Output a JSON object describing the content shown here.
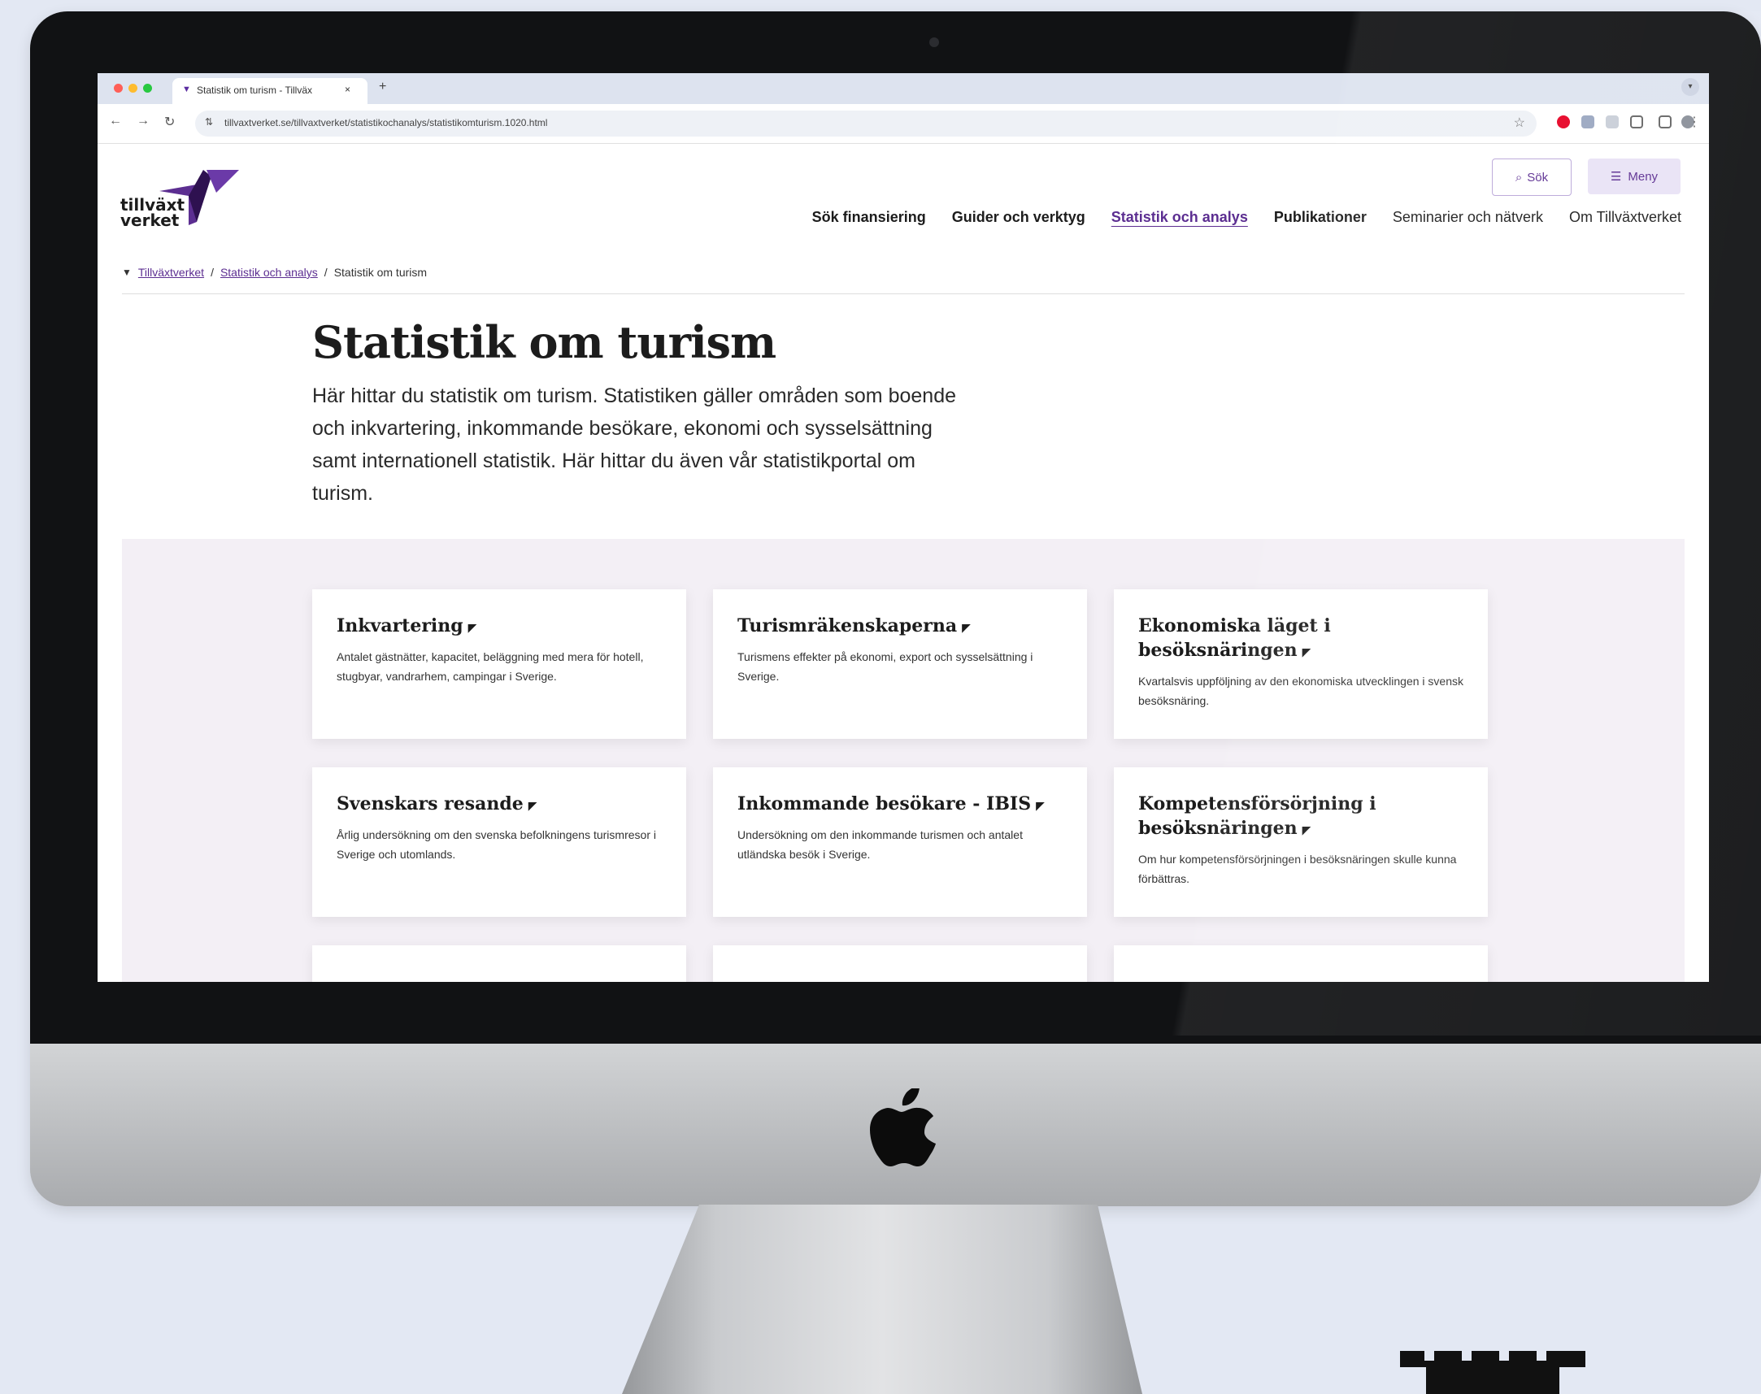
{
  "browser": {
    "tab_title": "Statistik om turism - Tillväx",
    "tab_close": "×",
    "new_tab": "+",
    "url": "tillvaxtverket.se/tillvaxtverket/statistikochanalys/statistikomturism.1020.html",
    "nav": {
      "back": "←",
      "forward": "→",
      "reload": "↻"
    },
    "traffic_colors": [
      "#ff5f57",
      "#febc2e",
      "#28c840"
    ]
  },
  "header": {
    "logo_line1": "tillväxt",
    "logo_line2": "verket",
    "search_label": "Sök",
    "menu_label": "Meny",
    "nav": [
      {
        "label": "Sök finansiering"
      },
      {
        "label": "Guider och verktyg"
      },
      {
        "label": "Statistik och analys"
      },
      {
        "label": "Publikationer"
      },
      {
        "label": "Seminarier och nätverk"
      },
      {
        "label": "Om Tillväxtverket"
      }
    ]
  },
  "breadcrumb": {
    "items": [
      "Tillväxtverket",
      "Statistik och analys",
      "Statistik om turism"
    ],
    "separator": "/"
  },
  "main": {
    "title": "Statistik om turism",
    "lead": "Här hittar du statistik om turism. Statistiken gäller områden som boende och inkvartering, inkommande besökare, ekonomi och sysselsättning samt internationell statistik. Här hittar du även vår statistikportal om turism."
  },
  "cards": [
    {
      "title": "Inkvartering",
      "desc": "Antalet gästnätter, kapacitet, beläggning med mera för hotell, stugbyar, vandrarhem, campingar i Sverige."
    },
    {
      "title": "Turismräkenskaperna",
      "desc": "Turismens effekter på ekonomi, export och sysselsättning i Sverige."
    },
    {
      "title": "Ekonomiska läget i besöksnäringen",
      "desc": "Kvartalsvis uppföljning av den ekonomiska utvecklingen i svensk besöksnäring."
    },
    {
      "title": "Svenskars resande",
      "desc": "Årlig undersökning om den svenska befolkningens turismresor i Sverige och utomlands."
    },
    {
      "title": "Inkommande besökare - IBIS",
      "desc": "Undersökning om den inkommande turismen och antalet utländska besök i Sverige."
    },
    {
      "title": "Kompetensförsörjning i besöksnäringen",
      "desc": "Om hur kompetensförsörjningen i besöksnäringen skulle kunna förbättras."
    }
  ],
  "colors": {
    "brand": "#5c2e91",
    "card_area": "#f3eff5"
  }
}
